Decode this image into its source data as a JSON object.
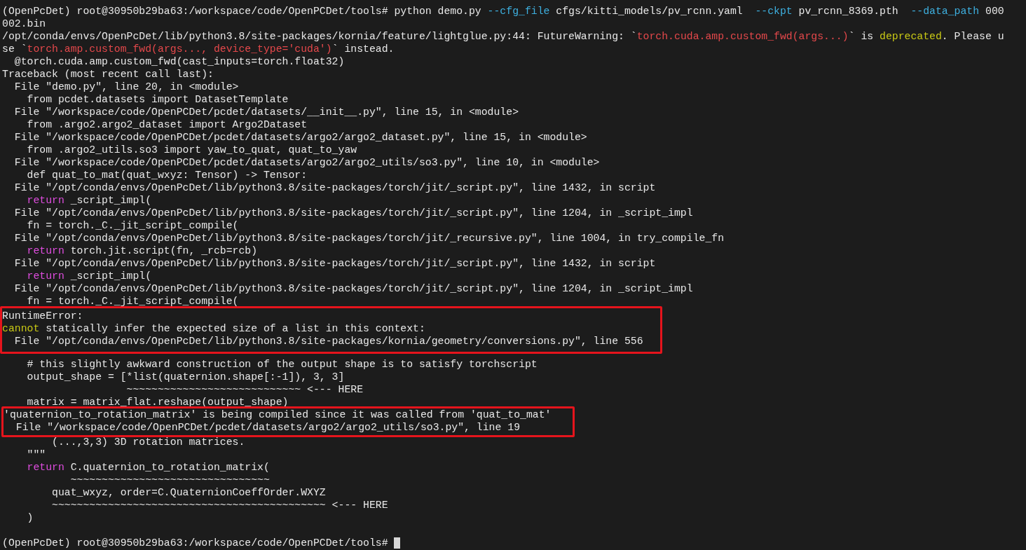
{
  "terminal": {
    "blocks": [
      {
        "kind": "plain",
        "lines": [
          {
            "kind": "text",
            "segments": [
              {
                "text": "(OpenPcDet) root@30950b29ba63:/workspace/code/OpenPCDet/tools# python demo.py "
              },
              {
                "text": "--cfg_file",
                "color": "#3eb0e0"
              },
              {
                "text": " cfgs/kitti_models/pv_rcnn.yaml  "
              },
              {
                "text": "--ckpt",
                "color": "#3eb0e0"
              },
              {
                "text": " pv_rcnn_8369.pth  "
              },
              {
                "text": "--data_path",
                "color": "#3eb0e0"
              },
              {
                "text": " 000"
              }
            ]
          },
          {
            "kind": "text",
            "segments": [
              {
                "text": "002.bin"
              }
            ]
          },
          {
            "kind": "text",
            "segments": [
              {
                "text": "/opt/conda/envs/OpenPcDet/lib/python3.8/site-packages/kornia/feature/lightglue.py:44: FutureWarning: `"
              },
              {
                "text": "torch.cuda.amp.custom_fwd(args...)",
                "color": "#e5484b"
              },
              {
                "text": "` is "
              },
              {
                "text": "deprecated",
                "color": "#c9c915"
              },
              {
                "text": ". Please u"
              }
            ]
          },
          {
            "kind": "text",
            "segments": [
              {
                "text": "se `"
              },
              {
                "text": "torch.amp.custom_fwd(args..., device_type='cuda')",
                "color": "#e5484b"
              },
              {
                "text": "` instead."
              }
            ]
          },
          {
            "kind": "text",
            "segments": [
              {
                "text": "  @torch.cuda.amp.custom_fwd(cast_inputs=torch.float32)"
              }
            ]
          },
          {
            "kind": "text",
            "segments": [
              {
                "text": "Traceback (most recent call last):"
              }
            ]
          },
          {
            "kind": "text",
            "segments": [
              {
                "text": "  File \"demo.py\", line 20, in <module>"
              }
            ]
          },
          {
            "kind": "text",
            "segments": [
              {
                "text": "    from pcdet.datasets import DatasetTemplate"
              }
            ]
          },
          {
            "kind": "text",
            "segments": [
              {
                "text": "  File \"/workspace/code/OpenPCDet/pcdet/datasets/__init__.py\", line 15, in <module>"
              }
            ]
          },
          {
            "kind": "text",
            "segments": [
              {
                "text": "    from .argo2.argo2_dataset import Argo2Dataset"
              }
            ]
          },
          {
            "kind": "text",
            "segments": [
              {
                "text": "  File \"/workspace/code/OpenPCDet/pcdet/datasets/argo2/argo2_dataset.py\", line 15, in <module>"
              }
            ]
          },
          {
            "kind": "text",
            "segments": [
              {
                "text": "    from .argo2_utils.so3 import yaw_to_quat, quat_to_yaw"
              }
            ]
          },
          {
            "kind": "text",
            "segments": [
              {
                "text": "  File \"/workspace/code/OpenPCDet/pcdet/datasets/argo2/argo2_utils/so3.py\", line 10, in <module>"
              }
            ]
          },
          {
            "kind": "text",
            "segments": [
              {
                "text": "    def quat_to_mat(quat_wxyz: Tensor) -> Tensor:"
              }
            ]
          },
          {
            "kind": "text",
            "segments": [
              {
                "text": "  File \"/opt/conda/envs/OpenPcDet/lib/python3.8/site-packages/torch/jit/_script.py\", line 1432, in script"
              }
            ]
          },
          {
            "kind": "text",
            "segments": [
              {
                "text": "    return",
                "color": "#e04de0"
              },
              {
                "text": " _script_impl("
              }
            ]
          },
          {
            "kind": "text",
            "segments": [
              {
                "text": "  File \"/opt/conda/envs/OpenPcDet/lib/python3.8/site-packages/torch/jit/_script.py\", line 1204, in _script_impl"
              }
            ]
          },
          {
            "kind": "text",
            "segments": [
              {
                "text": "    fn = torch._C._jit_script_compile("
              }
            ]
          },
          {
            "kind": "text",
            "segments": [
              {
                "text": "  File \"/opt/conda/envs/OpenPcDet/lib/python3.8/site-packages/torch/jit/_recursive.py\", line 1004, in try_compile_fn"
              }
            ]
          },
          {
            "kind": "text",
            "segments": [
              {
                "text": "    return",
                "color": "#e04de0"
              },
              {
                "text": " torch.jit.script(fn, _rcb=rcb)"
              }
            ]
          },
          {
            "kind": "text",
            "segments": [
              {
                "text": "  File \"/opt/conda/envs/OpenPcDet/lib/python3.8/site-packages/torch/jit/_script.py\", line 1432, in script"
              }
            ]
          },
          {
            "kind": "text",
            "segments": [
              {
                "text": "    return",
                "color": "#e04de0"
              },
              {
                "text": " _script_impl("
              }
            ]
          },
          {
            "kind": "text",
            "segments": [
              {
                "text": "  File \"/opt/conda/envs/OpenPcDet/lib/python3.8/site-packages/torch/jit/_script.py\", line 1204, in _script_impl"
              }
            ]
          },
          {
            "kind": "text",
            "segments": [
              {
                "text": "    fn = torch._C._jit_script_compile("
              }
            ]
          }
        ]
      },
      {
        "kind": "highlight",
        "lines": [
          {
            "kind": "text",
            "segments": [
              {
                "text": "RuntimeError:"
              }
            ]
          },
          {
            "kind": "text",
            "segments": [
              {
                "text": "cannot",
                "color": "#c9c915"
              },
              {
                "text": " statically infer the expected size of a list in this context:"
              }
            ]
          },
          {
            "kind": "text",
            "segments": [
              {
                "text": "  File \"/opt/conda/envs/OpenPcDet/lib/python3.8/site-packages/kornia/geometry/conversions.py\", line 556"
              }
            ]
          }
        ]
      },
      {
        "kind": "plain",
        "lines": [
          {
            "kind": "blank"
          },
          {
            "kind": "text",
            "segments": [
              {
                "text": "    # this slightly awkward construction of the output shape is to satisfy torchscript"
              }
            ]
          },
          {
            "kind": "text",
            "segments": [
              {
                "text": "    output_shape = [*list(quaternion.shape[:-1]), 3, 3]"
              }
            ]
          },
          {
            "kind": "text",
            "segments": [
              {
                "text": "                    ~~~~~~~~~~~~~~~~~~~~~~~~~~~~ <--- HERE"
              }
            ]
          },
          {
            "kind": "text",
            "segments": [
              {
                "text": "    matrix = matrix_flat.reshape(output_shape)"
              }
            ]
          }
        ]
      },
      {
        "kind": "highlight",
        "lines": [
          {
            "kind": "text",
            "segments": [
              {
                "text": "'quaternion_to_rotation_matrix' is being compiled since it was called from 'quat_to_mat'"
              }
            ]
          },
          {
            "kind": "text",
            "segments": [
              {
                "text": "  File \"/workspace/code/OpenPCDet/pcdet/datasets/argo2/argo2_utils/so3.py\", line 19"
              }
            ]
          }
        ]
      },
      {
        "kind": "plain",
        "lines": [
          {
            "kind": "text",
            "segments": [
              {
                "text": "        (...,3,3) 3D rotation matrices."
              }
            ]
          },
          {
            "kind": "text",
            "segments": [
              {
                "text": "    \"\"\""
              }
            ]
          },
          {
            "kind": "text",
            "segments": [
              {
                "text": "    return",
                "color": "#e04de0"
              },
              {
                "text": " C.quaternion_to_rotation_matrix("
              }
            ]
          },
          {
            "kind": "text",
            "segments": [
              {
                "text": "           ~~~~~~~~~~~~~~~~~~~~~~~~~~~~~~~~"
              }
            ]
          },
          {
            "kind": "text",
            "segments": [
              {
                "text": "        quat_wxyz, order=C.QuaternionCoeffOrder.WXYZ"
              }
            ]
          },
          {
            "kind": "text",
            "segments": [
              {
                "text": "        ~~~~~~~~~~~~~~~~~~~~~~~~~~~~~~~~~~~~~~~~~~~~ <--- HERE"
              }
            ]
          },
          {
            "kind": "text",
            "segments": [
              {
                "text": "    )"
              }
            ]
          },
          {
            "kind": "blank"
          },
          {
            "kind": "prompt",
            "segments": [
              {
                "text": "(OpenPcDet) root@30950b29ba63:/workspace/code/OpenPCDet/tools# "
              }
            ]
          }
        ]
      }
    ]
  }
}
